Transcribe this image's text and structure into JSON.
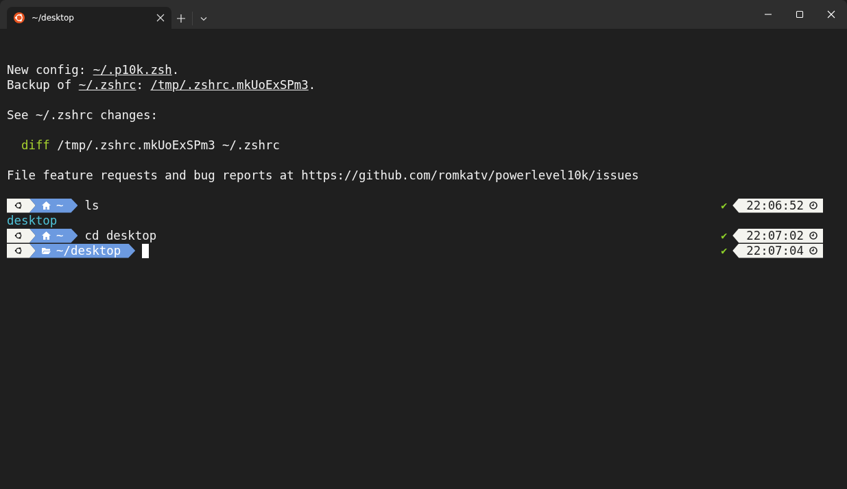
{
  "tabs": [
    {
      "title": "~/desktop",
      "selected": true
    }
  ],
  "lines": [
    {
      "kind": "blank"
    },
    {
      "kind": "text",
      "segments": [
        {
          "kind": "plain",
          "text": "New config: "
        },
        {
          "kind": "link",
          "text": "~/.p10k.zsh"
        },
        {
          "kind": "plain",
          "text": "."
        }
      ]
    },
    {
      "kind": "text",
      "segments": [
        {
          "kind": "plain",
          "text": "Backup of "
        },
        {
          "kind": "link",
          "text": "~/.zshrc"
        },
        {
          "kind": "plain",
          "text": ": "
        },
        {
          "kind": "link",
          "text": "/tmp/.zshrc.mkUoExSPm3"
        },
        {
          "kind": "plain",
          "text": "."
        }
      ]
    },
    {
      "kind": "blank"
    },
    {
      "kind": "text",
      "segments": [
        {
          "kind": "plain",
          "text": "See ~/.zshrc changes:"
        }
      ]
    },
    {
      "kind": "blank"
    },
    {
      "kind": "indented",
      "segments": [
        {
          "kind": "command",
          "text": "diff"
        },
        {
          "kind": "plain",
          "text": " /tmp/.zshrc.mkUoExSPm3 ~/.zshrc"
        }
      ]
    },
    {
      "kind": "blank"
    },
    {
      "kind": "text",
      "segments": [
        {
          "kind": "plain",
          "text": "File feature requests and bug reports at https://github.com/romkatv/powerlevel10k/issues"
        }
      ]
    },
    {
      "kind": "blank"
    },
    {
      "kind": "prompt",
      "directory": {
        "kind": "home",
        "path": "~"
      },
      "command": "ls",
      "status": "✔",
      "time": "22:06:52"
    },
    {
      "kind": "text",
      "segments": [
        {
          "kind": "directory",
          "text": "desktop"
        }
      ]
    },
    {
      "kind": "prompt",
      "directory": {
        "kind": "home",
        "path": "~"
      },
      "command": "cd desktop",
      "status": "✔",
      "time": "22:07:02"
    },
    {
      "kind": "prompt",
      "directory": {
        "kind": "folder",
        "path": "~/desktop"
      },
      "status": "✔",
      "time": "22:07:04",
      "cursor": true
    }
  ]
}
